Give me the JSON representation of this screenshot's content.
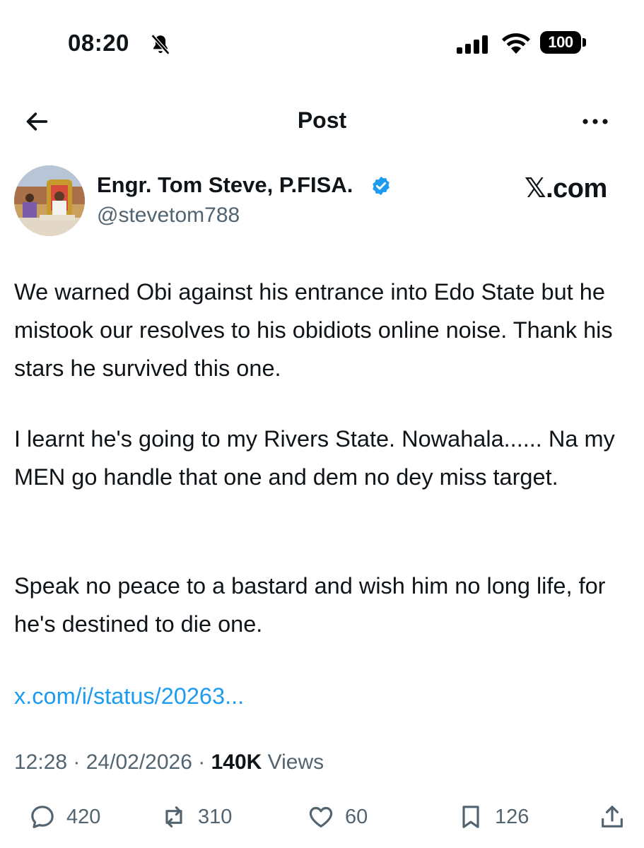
{
  "status_bar": {
    "time": "08:20",
    "bell_icon": "bell-slash-icon",
    "battery": "100"
  },
  "nav": {
    "title": "Post",
    "back_icon": "arrow-left-icon",
    "more_icon": "more-horizontal-icon"
  },
  "author": {
    "display_name": "Engr. Tom Steve, P.FISA.",
    "handle": "@stevetom788",
    "verified_icon": "verified-badge-icon",
    "watermark": "𝕏.com"
  },
  "post": {
    "paragraph_1": "We warned Obi against his entrance into Edo State but he mistook our resolves to his obidiots online noise. Thank his stars he survived this one.",
    "paragraph_2": "I learnt he's going to my Rivers State. Nowahala...... Na my MEN go handle that one and dem no dey miss target.",
    "paragraph_3": "Speak no peace to a bastard and wish him no long life, for he's destined to die one.",
    "link": "x.com/i/status/20263..."
  },
  "meta": {
    "time": "12:28",
    "date": "24/02/2026",
    "views_count": "140K",
    "views_label": "Views"
  },
  "actions": {
    "replies": "420",
    "reposts": "310",
    "likes": "60",
    "bookmarks": "126"
  },
  "colors": {
    "link": "#1d9bf0",
    "secondary_text": "#536471",
    "verified": "#1d9bf0"
  }
}
